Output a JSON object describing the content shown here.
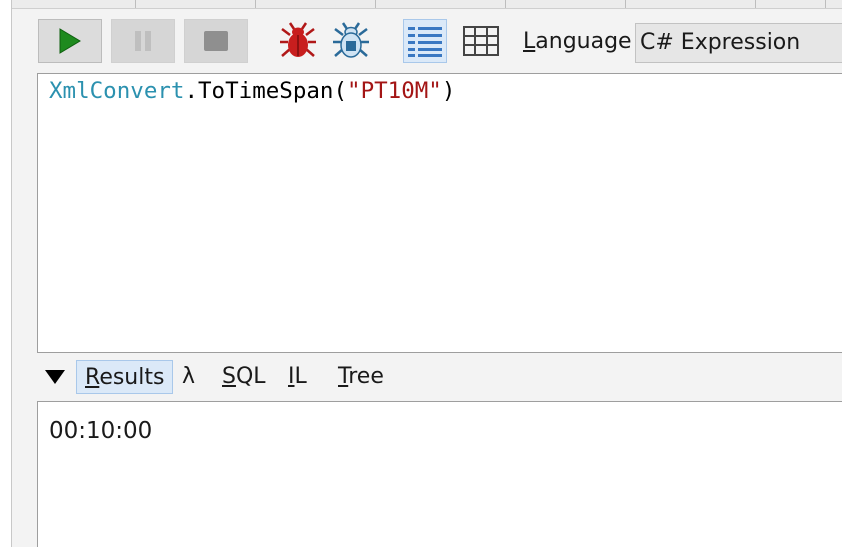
{
  "toolbar": {
    "run": {
      "icon": "play-icon",
      "color": "#1e8a1e"
    },
    "pause": {
      "icon": "pause-icon"
    },
    "stop": {
      "icon": "stop-icon"
    },
    "debug_icons": [
      "bug-icon",
      "bug-step-icon"
    ],
    "view_icons": [
      "rich-text-results-icon",
      "data-grid-results-icon"
    ],
    "language_label_prefix": "L",
    "language_label_rest": "anguage",
    "language_value": "C# Expression"
  },
  "editor": {
    "code_type": "XmlConvert",
    "code_method": ".ToTimeSpan(",
    "code_string": "\"PT10M\"",
    "code_close": ")",
    "colors": {
      "type": "#2b91af",
      "string": "#a31515"
    }
  },
  "results_tabs": {
    "collapse_icon": "triangle-down-icon",
    "results_u": "R",
    "results_rest": "esults",
    "lambda": "λ",
    "sql_u": "S",
    "sql_rest": "QL",
    "il_u": "I",
    "il_rest": "L",
    "tree_u": "T",
    "tree_rest": "ree"
  },
  "results": {
    "value": "00:10:00"
  }
}
